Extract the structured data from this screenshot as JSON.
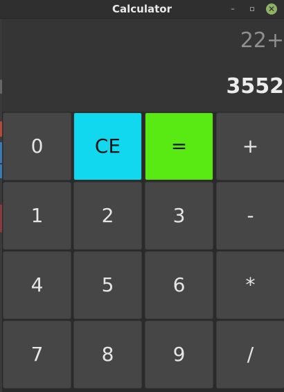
{
  "window": {
    "title": "Calculator"
  },
  "window_controls": {
    "minimize": "–",
    "maximize": "▫",
    "close": "✕"
  },
  "display": {
    "expression": "22+",
    "result": "3552"
  },
  "keys": {
    "row1": [
      "0",
      "CE",
      "=",
      "+"
    ],
    "row2": [
      "1",
      "2",
      "3",
      "-"
    ],
    "row3": [
      "4",
      "5",
      "6",
      "*"
    ],
    "row4": [
      "7",
      "8",
      "9",
      "/"
    ]
  },
  "colors": {
    "ce_key": "#11d8ee",
    "equals_key": "#58ea12",
    "key": "#464646",
    "display": "#353535"
  }
}
